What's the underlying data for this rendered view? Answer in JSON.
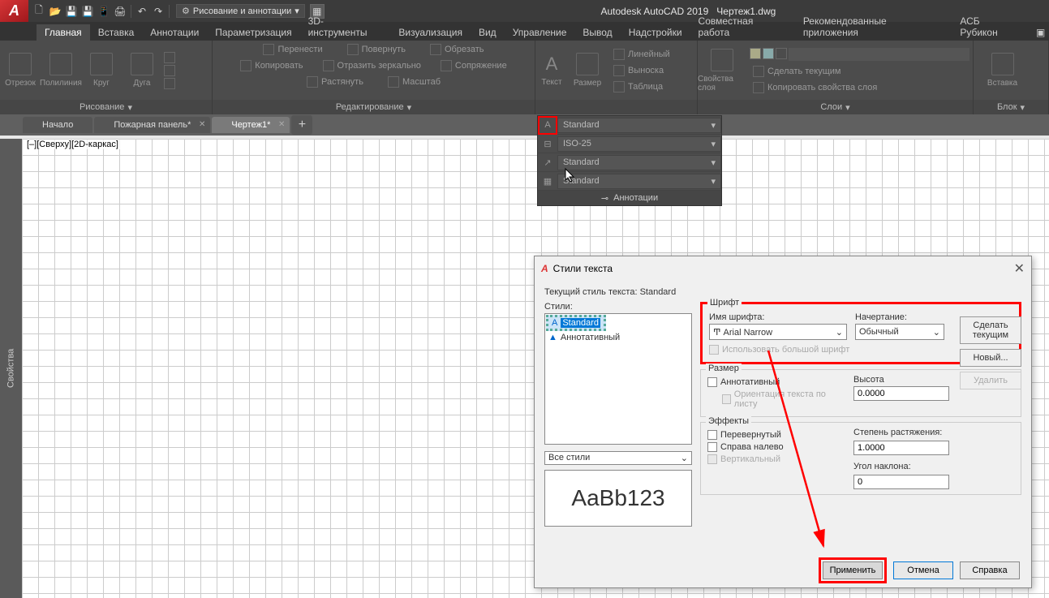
{
  "titlebar": {
    "app_letter": "A",
    "workspace": "Рисование и аннотации",
    "app_name": "Autodesk AutoCAD 2019",
    "doc_name": "Чертеж1.dwg"
  },
  "menu": {
    "tabs": [
      "Главная",
      "Вставка",
      "Аннотации",
      "Параметризация",
      "3D-инструменты",
      "Визуализация",
      "Вид",
      "Управление",
      "Вывод",
      "Надстройки",
      "Совместная работа",
      "Рекомендованные приложения",
      "АСБ Рубикон"
    ],
    "active_index": 0
  },
  "ribbon": {
    "panels": {
      "draw": {
        "title": "Рисование",
        "btns": [
          "Отрезок",
          "Полилиния",
          "Круг",
          "Дуга"
        ]
      },
      "modify": {
        "title": "Редактирование",
        "rows": [
          [
            "Перенести",
            "Повернуть",
            "Обрезать"
          ],
          [
            "Копировать",
            "Отразить зеркально",
            "Сопряжение"
          ],
          [
            "Растянуть",
            "Масштаб"
          ]
        ]
      },
      "anno": {
        "text": "Текст",
        "dim": "Размер",
        "lin": "Линейный",
        "vyn": "Выноска",
        "tbl": "Таблица"
      },
      "layers": {
        "title": "Слои",
        "props": "Свойства слоя",
        "make_current": "Сделать текущим",
        "copy_props": "Копировать свойства слоя"
      },
      "block": {
        "title": "Блок",
        "insert": "Вставка"
      }
    }
  },
  "doctabs": {
    "tabs": [
      {
        "label": "Начало",
        "active": false,
        "modified": false
      },
      {
        "label": "Пожарная панель*",
        "active": false,
        "modified": true
      },
      {
        "label": "Чертеж1*",
        "active": true,
        "modified": true
      }
    ]
  },
  "viewport_label": "[–][Сверху][2D-каркас]",
  "props_sidebar": "Свойства",
  "anno_flyout": {
    "rows": [
      "Standard",
      "ISO-25",
      "Standard",
      "Standard"
    ],
    "title": "Аннотации"
  },
  "dialog": {
    "title": "Стили текста",
    "current_label": "Текущий стиль текста:",
    "current_value": "Standard",
    "styles_label": "Стили:",
    "styles": [
      "Standard",
      "Аннотативный"
    ],
    "filter": "Все стили",
    "preview": "AaBb123",
    "font_group": "Шрифт",
    "font_name_label": "Имя шрифта:",
    "font_name": "Arial Narrow",
    "font_style_label": "Начертание:",
    "font_style": "Обычный",
    "big_font_cb": "Использовать большой шрифт",
    "size_group": "Размер",
    "anno_cb": "Аннотативный",
    "orient_cb": "Ориентация текста по листу",
    "height_label": "Высота",
    "height_val": "0.0000",
    "effects_group": "Эффекты",
    "flip_cb": "Перевернутый",
    "rtl_cb": "Справа налево",
    "vert_cb": "Вертикальный",
    "width_label": "Степень растяжения:",
    "width_val": "1.0000",
    "oblique_label": "Угол наклона:",
    "oblique_val": "0",
    "btns": {
      "set_current": "Сделать текущим",
      "new": "Новый...",
      "delete": "Удалить",
      "apply": "Применить",
      "cancel": "Отмена",
      "help": "Справка"
    }
  }
}
